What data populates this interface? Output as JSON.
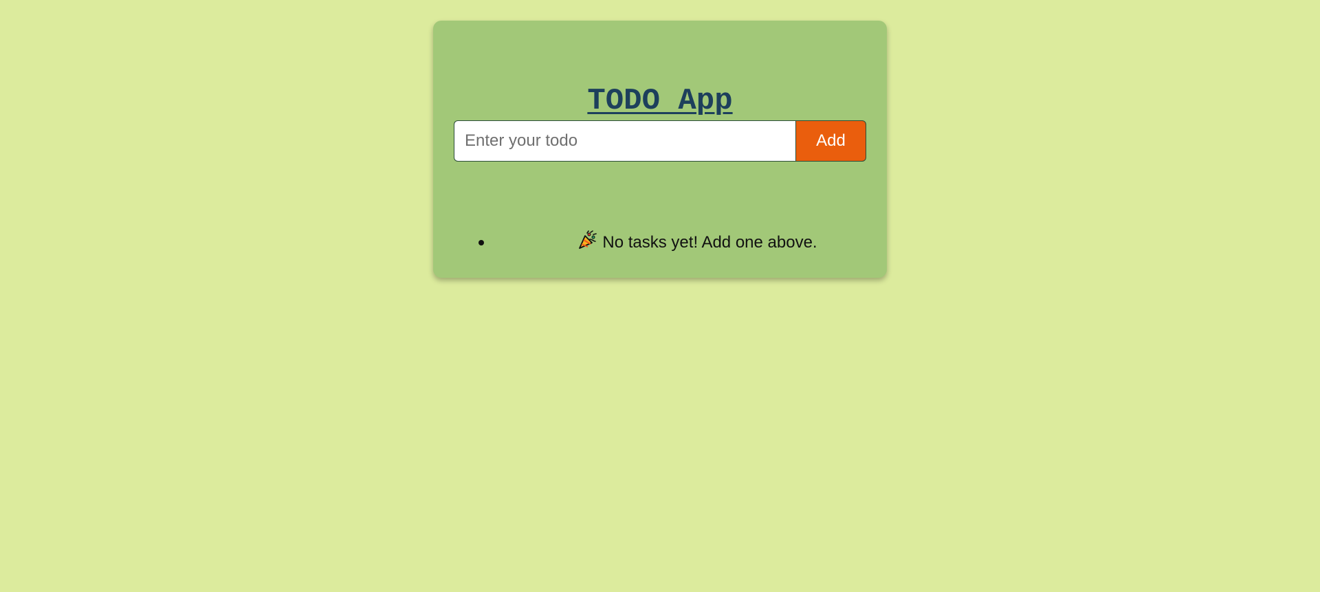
{
  "app": {
    "title": "TODO App"
  },
  "form": {
    "placeholder": "Enter your todo",
    "value": "",
    "add_label": "Add"
  },
  "todos": {
    "items": [],
    "empty_message": "No tasks yet! Add one above.",
    "empty_icon": "party-popper-icon"
  },
  "colors": {
    "background": "#dceb9d",
    "card": "#a2c878",
    "title": "#1d3f5c",
    "add_button": "#ea5e0d"
  }
}
